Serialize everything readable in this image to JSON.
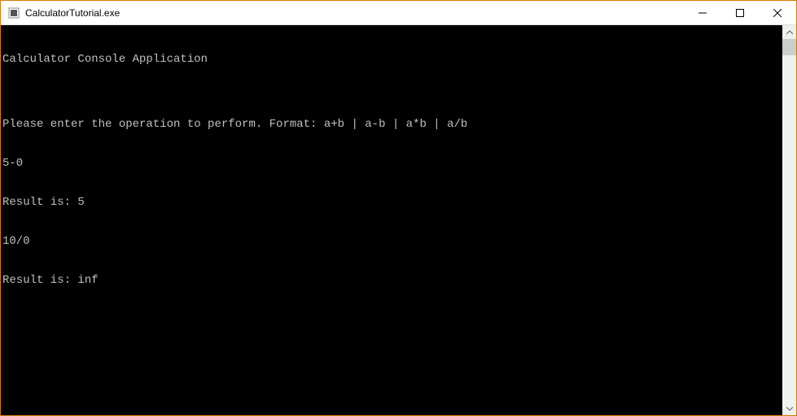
{
  "window": {
    "title": "CalculatorTutorial.exe"
  },
  "console": {
    "lines": [
      "Calculator Console Application",
      "",
      "Please enter the operation to perform. Format: a+b | a-b | a*b | a/b",
      "5-0",
      "Result is: 5",
      "10/0",
      "Result is: inf"
    ]
  }
}
